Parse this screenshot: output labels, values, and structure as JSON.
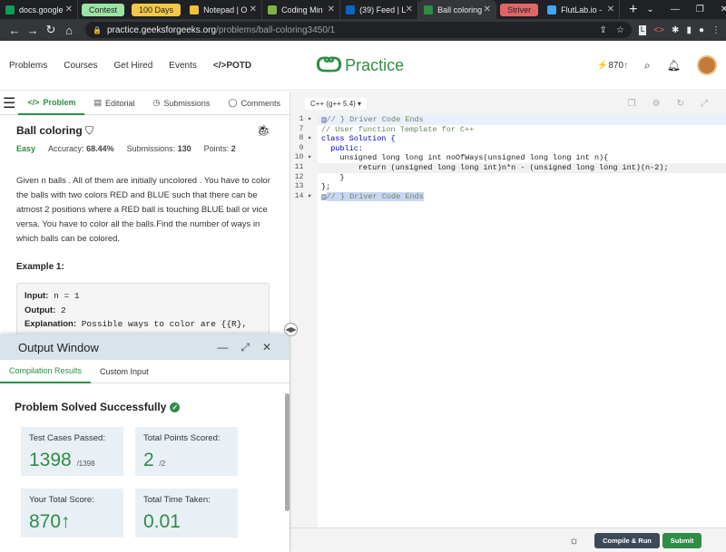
{
  "browser": {
    "tabs": [
      {
        "label": "docs.google",
        "icon": "sheets-icon",
        "color": "#0f9d58"
      },
      {
        "label": "Contest",
        "pill": true,
        "bg": "#9ce3a6"
      },
      {
        "label": "100 Days",
        "pill": true,
        "bg": "#f2c84b"
      },
      {
        "label": "Notepad | O",
        "icon": "notepad-icon",
        "color": "#f1c232"
      },
      {
        "label": "Coding Min",
        "icon": "check-circle-icon",
        "color": "#7cb342"
      },
      {
        "label": "(39) Feed | L",
        "icon": "linkedin-icon",
        "color": "#0a66c2"
      },
      {
        "label": "Ball coloring",
        "icon": "gfg-icon",
        "color": "#2f8d46",
        "active": true
      },
      {
        "label": "Striver",
        "pill": true,
        "bg": "#e06666"
      },
      {
        "label": "FlutLab.io -",
        "icon": "flutlab-icon",
        "color": "#42a5f5"
      }
    ],
    "url_domain": "practice.geeksforgeeks.org",
    "url_path": "/problems/ball-coloring3450/1"
  },
  "nav": {
    "links": [
      "Problems",
      "Courses",
      "Get Hired",
      "Events",
      "</>POTD"
    ],
    "logo_text": "Practice",
    "streak": "870"
  },
  "left_tabs": [
    "Problem",
    "Editorial",
    "Submissions",
    "Comments"
  ],
  "problem": {
    "title": "Ball coloring",
    "difficulty": "Easy",
    "accuracy_label": "Accuracy:",
    "accuracy": "68.44%",
    "submissions_label": "Submissions:",
    "submissions": "130",
    "points_label": "Points:",
    "points": "2",
    "description": "Given n balls . All of them are initially  uncolored . You have to color the balls with two colors RED and BLUE such that there can be atmost 2 positions where a RED ball is touching BLUE ball or vice versa. You have to color all the balls.Find the number of ways in which balls can be colored.",
    "example_title": "Example 1:",
    "input_label": "Input:",
    "input_value": "n = 1",
    "output_label": "Output:",
    "output_value": "2",
    "explanation_label": "Explanation:",
    "explanation_value": "Possible ways to color are {{R},{B}}."
  },
  "editor": {
    "language": "C++ (g++ 5.4)",
    "lines": [
      {
        "n": "1",
        "text": "// } Driver Code Ends",
        "fold": true,
        "hl": true
      },
      {
        "n": "7",
        "text": "// User function Template for C++"
      },
      {
        "n": "8",
        "text": "class Solution {",
        "arrow": true
      },
      {
        "n": "9",
        "text": "  public:"
      },
      {
        "n": "10",
        "text": "    unsigned long long int noOfWays(unsigned long long int n){",
        "arrow": true
      },
      {
        "n": "11",
        "text": "        return (unsigned long long int)n*n - (unsigned long long int)(n-2);",
        "cur": true
      },
      {
        "n": "12",
        "text": "    }"
      },
      {
        "n": "13",
        "text": "};"
      },
      {
        "n": "14",
        "text": "// } Driver Code Ends",
        "fold": true,
        "sel": true
      }
    ],
    "compile_label": "Compile & Run",
    "submit_label": "Submit"
  },
  "output": {
    "title": "Output Window",
    "tabs": [
      "Compilation Results",
      "Custom Input"
    ],
    "status": "Problem Solved Successfully",
    "cards": [
      {
        "label": "Test Cases Passed:",
        "value": "1398",
        "sub": "/1398"
      },
      {
        "label": "Total Points Scored:",
        "value": "2",
        "sub": "/2"
      },
      {
        "label": "Your Total Score:",
        "value": "870",
        "sub": "",
        "arrow": true
      },
      {
        "label": "Total Time Taken:",
        "value": "0.01",
        "sub": ""
      }
    ]
  }
}
